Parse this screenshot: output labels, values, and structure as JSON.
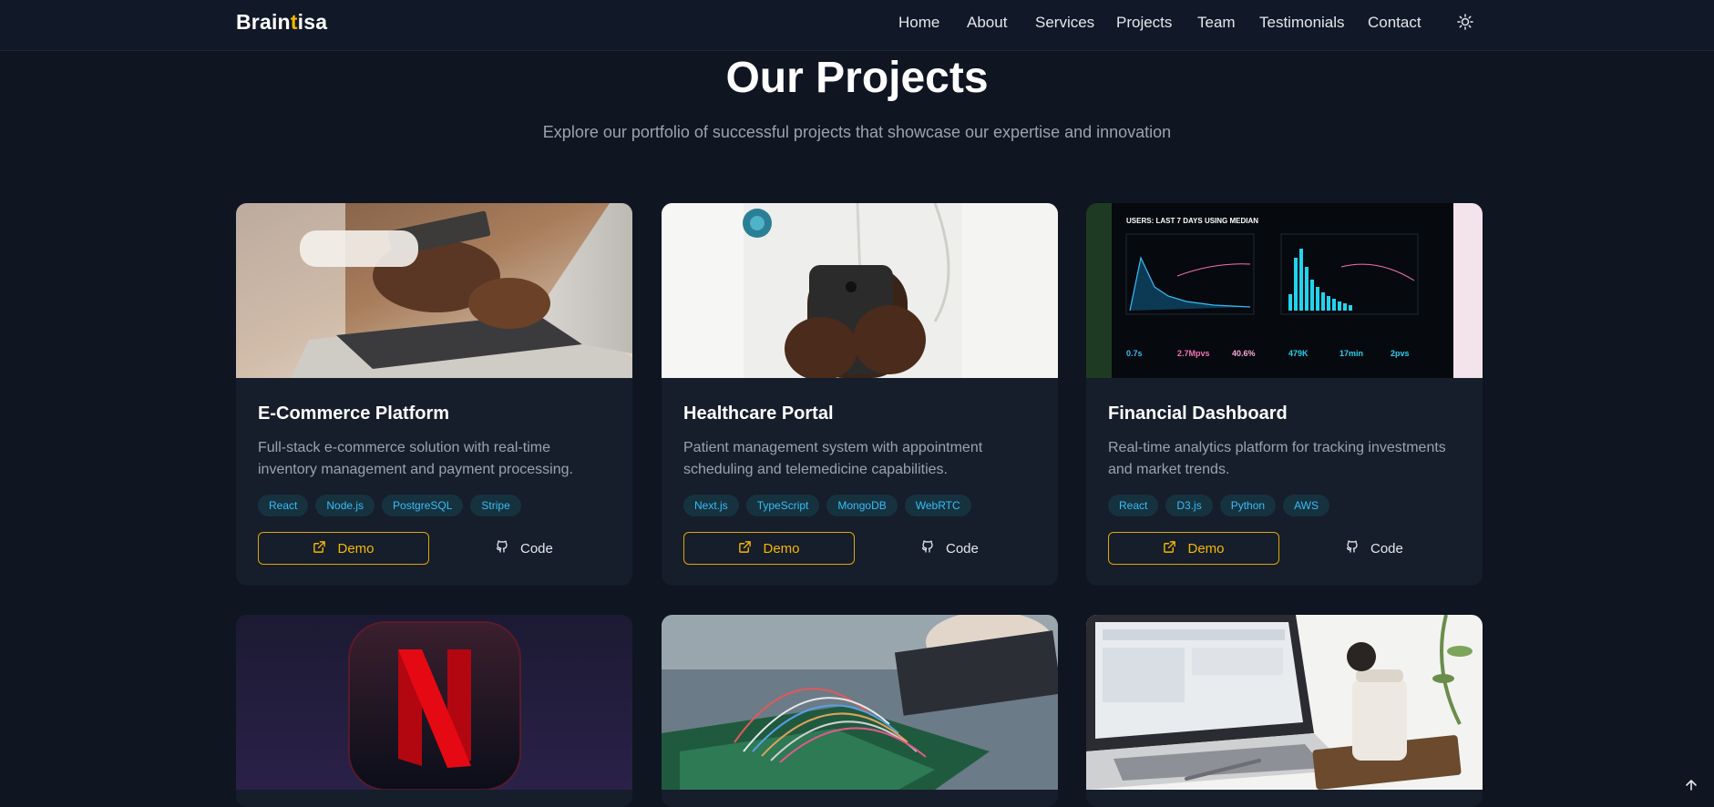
{
  "navbar": {
    "brand_prefix": "Brain",
    "brand_accent": "t",
    "brand_suffix": "isa",
    "links": [
      "Home",
      "About",
      "Services",
      "Projects",
      "Team",
      "Testimonials",
      "Contact"
    ],
    "theme_icon": "sun-icon"
  },
  "header": {
    "title": "Our Projects",
    "subtitle": "Explore our portfolio of successful projects that showcase our expertise and innovation"
  },
  "projects": [
    {
      "title": "E-Commerce Platform",
      "description": "Full-stack e-commerce solution with real-time inventory management and payment processing.",
      "tags": [
        "React",
        "Node.js",
        "PostgreSQL",
        "Stripe"
      ],
      "demo_label": "Demo",
      "code_label": "Code"
    },
    {
      "title": "Healthcare Portal",
      "description": "Patient management system with appointment scheduling and telemedicine capabilities.",
      "tags": [
        "Next.js",
        "TypeScript",
        "MongoDB",
        "WebRTC"
      ],
      "demo_label": "Demo",
      "code_label": "Code"
    },
    {
      "title": "Financial Dashboard",
      "description": "Real-time analytics platform for tracking investments and market trends.",
      "tags": [
        "React",
        "D3.js",
        "Python",
        "AWS"
      ],
      "demo_label": "Demo",
      "code_label": "Code"
    }
  ],
  "dashboard_image": {
    "heading": "USERS: LAST 7 DAYS USING MEDIAN",
    "metrics": [
      "0.7s",
      "2.7Mpvs",
      "40.6%",
      "479K",
      "17min",
      "2pvs"
    ]
  },
  "colors": {
    "background": "#0f1521",
    "card": "#161d2b",
    "accent": "#f5b800",
    "tag_text": "#38bdf8",
    "muted_text": "#9ca3af"
  },
  "icons": {
    "demo": "external-link-icon",
    "code": "github-icon",
    "scroll_top": "arrow-up-icon"
  }
}
